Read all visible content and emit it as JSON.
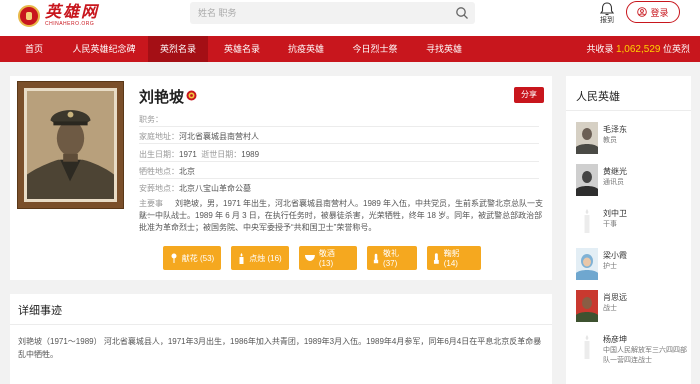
{
  "header": {
    "logo_main": "英雄网",
    "logo_sub": "CHINAHERO.ORG",
    "search_placeholder": "姓名 职务",
    "notify_label": "报到",
    "login_label": "登录"
  },
  "nav": {
    "items": [
      "首页",
      "人民英雄纪念碑",
      "英烈名录",
      "英雄名录",
      "抗疫英雄",
      "今日烈士祭",
      "寻找英雄"
    ],
    "active_index": 2,
    "count_prefix": "共收录",
    "count_value": "1,062,529",
    "count_suffix": "位英烈"
  },
  "hero": {
    "name": "刘艳坡",
    "share_label": "分享",
    "duty_label": "职务：",
    "duty_value": "",
    "home_label": "家庭地址：",
    "home_value": "河北省襄城县南营村人",
    "birth_label": "出生日期：",
    "birth_value": "1971",
    "death_label": "逝世日期：",
    "death_value": "1989",
    "sacrifice_label": "牺牲地点：",
    "sacrifice_value": "北京",
    "burial_label": "安葬地点：",
    "burial_value": "北京八宝山革命公墓",
    "story_label": "主要事迹：",
    "story_text": "刘艳坡，男，1971 年出生，河北省襄城县南营村人。1989 年入伍，中共党员，生前系武警北京总队一支队一中队战士。1989 年 6 月 3 日，在执行任务时，被暴徒杀害，光荣牺牲，终年 18 岁。同年，被武警总部政治部批准为革命烈士；被国务院、中央军委授予“共和国卫士”荣誉称号。"
  },
  "actions": [
    {
      "label": "献花 (53)",
      "icon": "flower-icon"
    },
    {
      "label": "点烛 (16)",
      "icon": "candle-icon"
    },
    {
      "label": "敬酒 (13)",
      "icon": "wine-icon"
    },
    {
      "label": "敬礼 (37)",
      "icon": "salute-icon"
    },
    {
      "label": "鞠躬 (14)",
      "icon": "bow-icon"
    }
  ],
  "detail": {
    "title": "详细事迹",
    "text": "刘艳坡（1971～1989）  河北省襄城县人，1971年3月出生，1986年加入共青团，1989年3月入伍。1989年4月参军，同年6月4日在平息北京反革命暴乱中牺牲。"
  },
  "sidebar": {
    "title": "人民英雄",
    "heroes": [
      {
        "name": "毛泽东",
        "title": "教员"
      },
      {
        "name": "黄继光",
        "title": "通讯员"
      },
      {
        "name": "刘中卫",
        "title": "干事"
      },
      {
        "name": "梁小霞",
        "title": "护士"
      },
      {
        "name": "肖思远",
        "title": "战士"
      },
      {
        "name": "杨彦坤",
        "title": "中国人民解放军三六四四部队一营四连战士"
      }
    ]
  },
  "colors": {
    "brand_red": "#c8161d",
    "action_orange": "#f5a81f",
    "count_yellow": "#ffd200"
  }
}
